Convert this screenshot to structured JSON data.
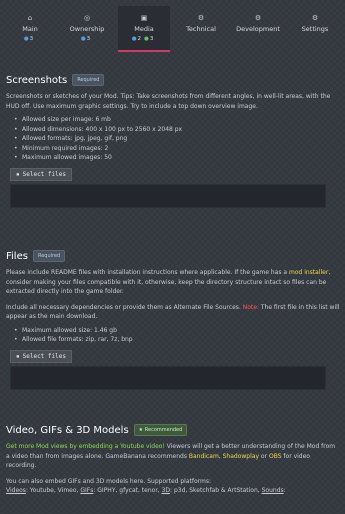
{
  "tabs": [
    {
      "label": "Main",
      "icon": "home-icon",
      "glyph": "⌂",
      "counts": [
        {
          "c": "blue",
          "v": "3"
        }
      ]
    },
    {
      "label": "Ownership",
      "icon": "ownership-icon",
      "glyph": "◎",
      "counts": [
        {
          "c": "blue",
          "v": "3"
        }
      ]
    },
    {
      "label": "Media",
      "icon": "media-icon",
      "glyph": "▣",
      "counts": [
        {
          "c": "blue",
          "v": "2"
        },
        {
          "c": "green",
          "v": "3"
        }
      ],
      "active": true
    },
    {
      "label": "Technical",
      "icon": "technical-icon",
      "glyph": "⚙",
      "counts": []
    },
    {
      "label": "Development",
      "icon": "development-icon",
      "glyph": "⚙",
      "counts": []
    },
    {
      "label": "Settings",
      "icon": "settings-icon",
      "glyph": "⚙",
      "counts": []
    }
  ],
  "screenshots": {
    "title": "Screenshots",
    "badge": "Required",
    "description": "Screenshots or sketches of your Mod. Tips: Take screenshots from different angles, in well-lit areas, with the HUD off. Use maximum graphic settings. Try to include a top down overview image.",
    "rules": [
      "Allowed size per image: 6 mb",
      "Allowed dimensions: 400 x 100 px to 2560 x 2048 px",
      "Allowed formats: jpg, jpeg, gif, png",
      "Minimum required images: 2",
      "Maximum allowed images: 50"
    ],
    "select_label": "Select files"
  },
  "files": {
    "title": "Files",
    "badge": "Required",
    "desc_part1": "Please include README files with installation instructions where applicable. If the game has a ",
    "desc_highlight": "mod installer",
    "desc_part2": ", consider making your files compatible with it, otherwise, keep the directory structure intact so files can be extracted directly into the game folder.",
    "desc2_part1": "Include all necessary dependencies or provide them as Alternate File Sources. ",
    "desc2_note": "Note:",
    "desc2_part2": " The first file in this list will appear as the main download.",
    "rules": [
      "Maximum allowed size: 1.46 gb",
      "Allowed file formats: zip, rar, 7z, bnp"
    ],
    "select_label": "Select files"
  },
  "video": {
    "title": "Video, GIFs & 3D Models",
    "badge": "Recommended",
    "desc_green": "Get more Mod views by embedding a Youtube video!",
    "desc_part": " Viewers will get a better understanding of the Mod from a video than from images alone. GameBanana recommends ",
    "link1": "Bandicam",
    "sep1": ", ",
    "link2": "Shadowplay",
    "or": " or ",
    "link3": "OBS",
    "end": " for video recording.",
    "platforms_intro": "You can also embed GIFs and 3D models here. Supported platforms:",
    "platforms_line": [
      {
        "k": "Videos",
        "v": ": Youtube, Vimeo, "
      },
      {
        "k": "GIFs",
        "v": ": GIPHY, gfycat, tenor, "
      },
      {
        "k": "3D",
        "v": ": p3d, Sketchfab & ArtStation, "
      },
      {
        "k": "Sounds",
        "v": ":"
      }
    ]
  },
  "colors": {
    "accent": "#d23a63",
    "badge_blue_dot": "#4fa1e6",
    "badge_green_dot": "#62c25a"
  }
}
